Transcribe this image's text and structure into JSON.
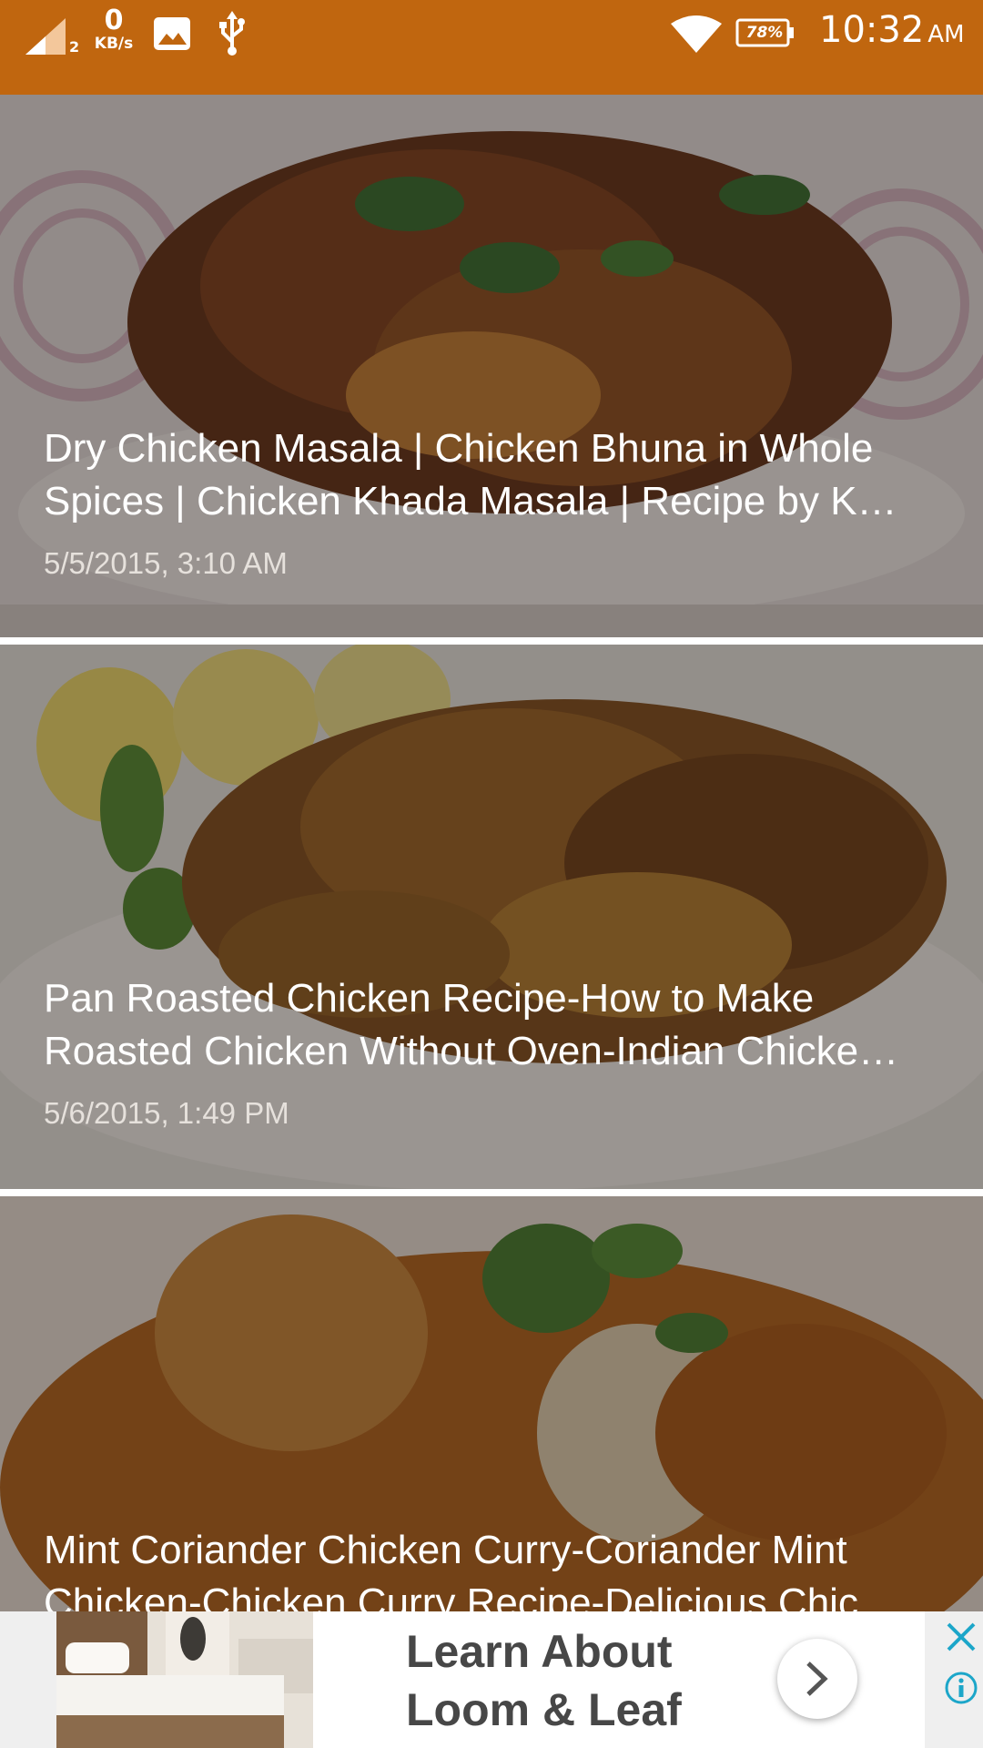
{
  "status_bar": {
    "sim_slot": "2",
    "net_speed_value": "0",
    "net_speed_unit": "KB/s",
    "battery_percent": "78%",
    "time": "10:32",
    "time_suffix": "AM",
    "icons": [
      "signal-icon",
      "image-notification-icon",
      "usb-icon",
      "wifi-icon",
      "battery-icon"
    ],
    "color": "#c0660f"
  },
  "videos": [
    {
      "title": "Dry Chicken Masala | Chicken Bhuna in Whole Spices | Chicken Khada Masala | Recipe by K…",
      "date": "5/5/2015, 3:10 AM"
    },
    {
      "title": "Pan Roasted Chicken Recipe-How to Make Roasted Chicken Without Oven-Indian Chicke…",
      "date": "5/6/2015, 1:49 PM"
    },
    {
      "title": "Mint Coriander Chicken Curry-Coriander Mint Chicken-Chicken Curry Recipe-Delicious Chic…"
    }
  ],
  "ad": {
    "headline": "Learn About Loom & Leaf",
    "icons": [
      "arrow-right-icon",
      "close-icon",
      "info-icon"
    ],
    "accent_color": "#1ca6c9"
  }
}
